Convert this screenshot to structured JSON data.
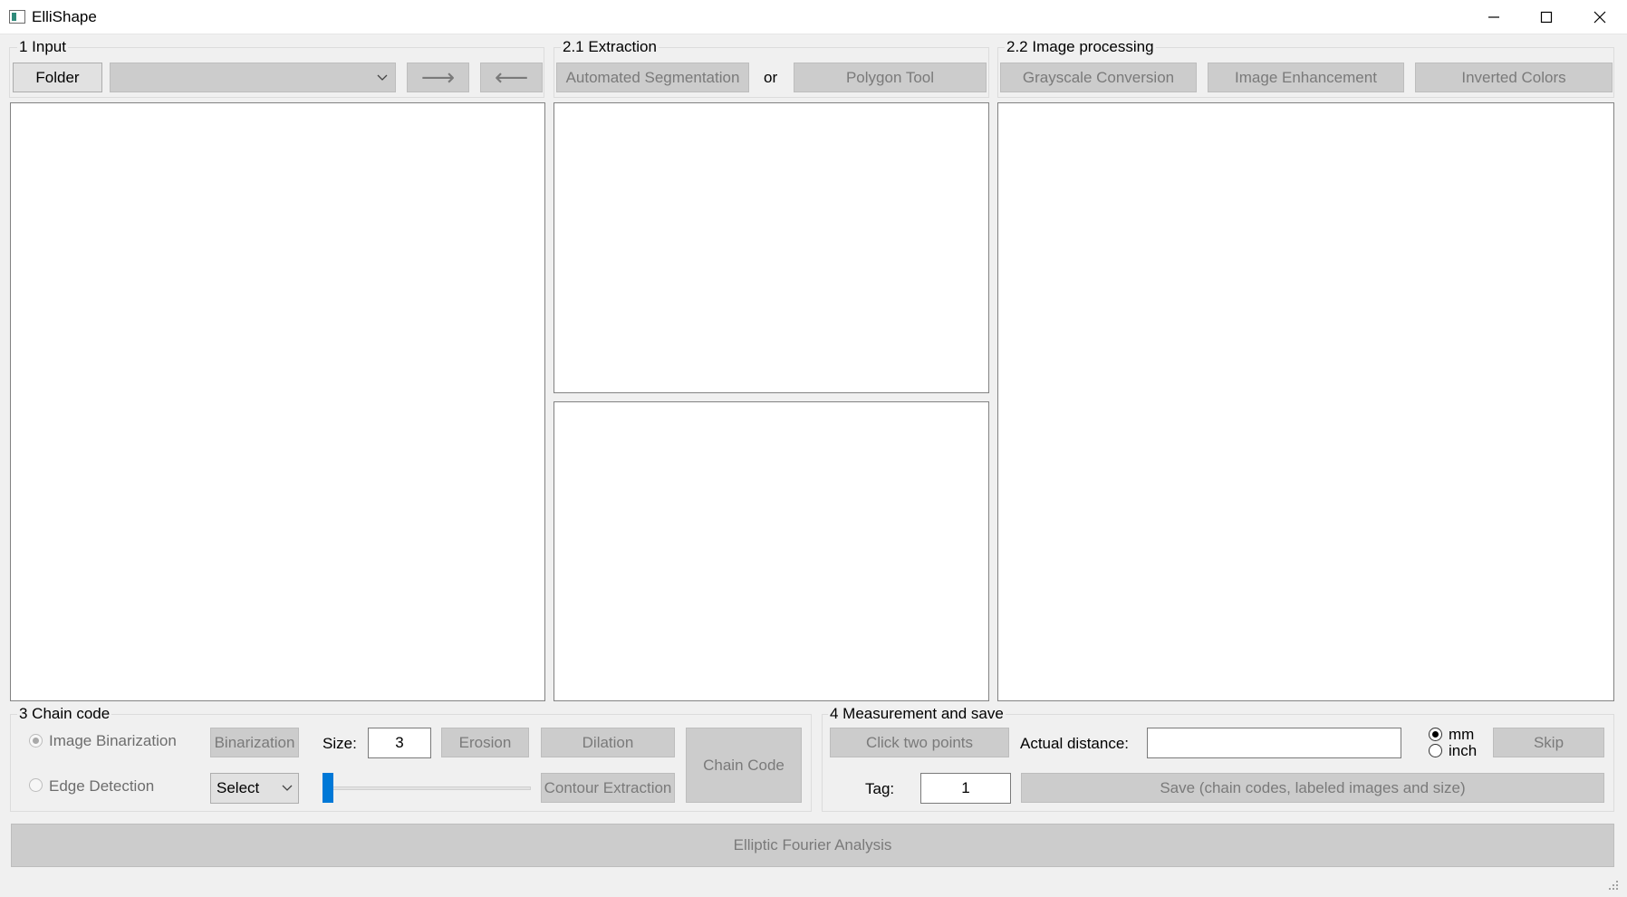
{
  "window": {
    "title": "ElliShape"
  },
  "input_group": {
    "label": "1 Input",
    "folder_button": "Folder",
    "file_select_value": "",
    "next_arrow": "⟶",
    "prev_arrow": "⟵"
  },
  "extraction_group": {
    "label": "2.1 Extraction",
    "auto_seg_button": "Automated Segmentation",
    "or_text": "or",
    "polygon_button": "Polygon Tool"
  },
  "processing_group": {
    "label": "2.2 Image processing",
    "grayscale_button": "Grayscale Conversion",
    "enhancement_button": "Image Enhancement",
    "invert_button": "Inverted Colors"
  },
  "chain_group": {
    "label": "3 Chain code",
    "binarization_radio": "Image Binarization",
    "edge_radio": "Edge Detection",
    "binarization_button": "Binarization",
    "size_label": "Size:",
    "size_value": "3",
    "erosion_button": "Erosion",
    "dilation_button": "Dilation",
    "edge_select_value": "Select",
    "contour_button": "Contour Extraction",
    "chain_code_button": "Chain Code"
  },
  "measure_group": {
    "label": "4 Measurement and save",
    "click_points_button": "Click two points",
    "distance_label": "Actual distance:",
    "distance_value": "",
    "unit_mm": "mm",
    "unit_inch": "inch",
    "skip_button": "Skip",
    "tag_label": "Tag:",
    "tag_value": "1",
    "save_button": "Save (chain codes, labeled images and size)"
  },
  "efa_button": "Elliptic Fourier Analysis"
}
